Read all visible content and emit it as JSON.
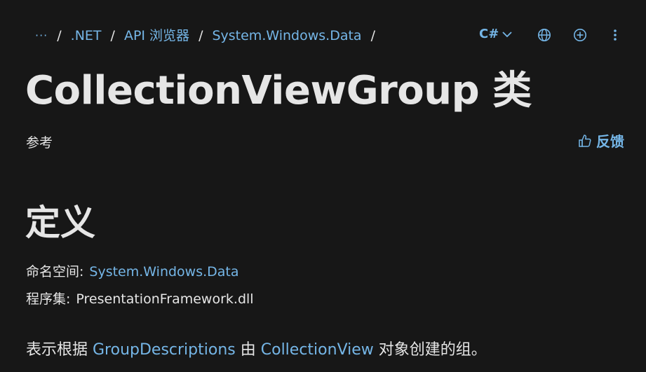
{
  "breadcrumb": {
    "ellipsis": "···",
    "items": [
      ".NET",
      "API 浏览器",
      "System.Windows.Data"
    ],
    "separator": "/"
  },
  "toolbar": {
    "language": "C#",
    "icons": [
      "chevron-down-icon",
      "globe-icon",
      "add-circle-icon",
      "more-vertical-icon"
    ]
  },
  "title": "CollectionViewGroup 类",
  "subtitle": "参考",
  "feedback": {
    "label": "反馈",
    "icon": "thumbs-up-icon"
  },
  "definition": {
    "heading": "定义",
    "namespace_label": "命名空间:",
    "namespace_value": "System.Windows.Data",
    "assembly_label": "程序集:",
    "assembly_value": "PresentationFramework.dll"
  },
  "summary": {
    "part1": "表示根据 ",
    "link1": "GroupDescriptions",
    "part2": " 由 ",
    "link2": "CollectionView",
    "part3": " 对象创建的组。"
  },
  "colors": {
    "background": "#171717",
    "text": "#e6e6e6",
    "link": "#75b6e7"
  }
}
